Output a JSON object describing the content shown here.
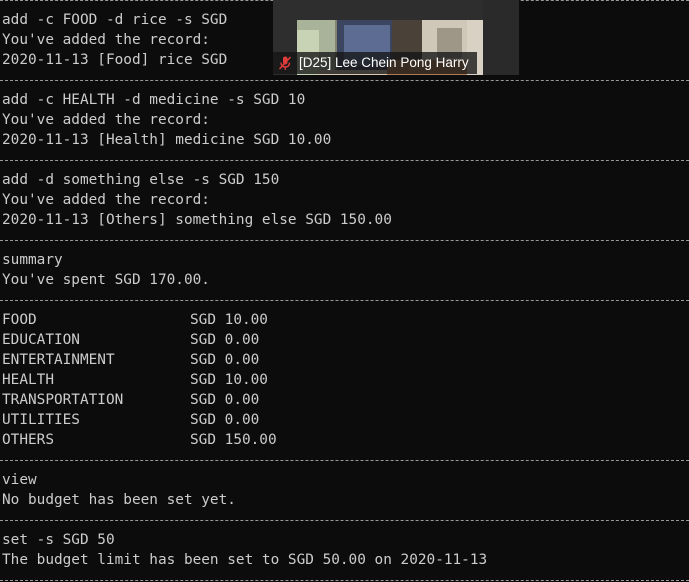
{
  "terminal": {
    "lines": {
      "l0": "add -c FOOD -d rice -s SGD",
      "l1": "You've added the record:",
      "l2": "2020-11-13 [Food] rice SGD",
      "l3": "add -c HEALTH -d medicine -s SGD 10",
      "l4": "You've added the record:",
      "l5": "2020-11-13 [Health] medicine SGD 10.00",
      "l6": "add -d something else -s SGD 150",
      "l7": "You've added the record:",
      "l8": "2020-11-13 [Others] something else SGD 150.00",
      "l9": "summary",
      "l10": "You've spent SGD 170.00.",
      "l11": "view",
      "l12": "No budget has been set yet.",
      "l13": "set -s SGD 50",
      "l14": "The budget limit has been set to SGD 50.00 on 2020-11-13"
    },
    "categories": [
      {
        "name": "FOOD",
        "amount": "SGD 10.00"
      },
      {
        "name": "EDUCATION",
        "amount": "SGD 0.00"
      },
      {
        "name": "ENTERTAINMENT",
        "amount": "SGD 0.00"
      },
      {
        "name": "HEALTH",
        "amount": "SGD 10.00"
      },
      {
        "name": "TRANSPORTATION",
        "amount": "SGD 0.00"
      },
      {
        "name": "UTILITIES",
        "amount": "SGD 0.00"
      },
      {
        "name": "OTHERS",
        "amount": "SGD 150.00"
      }
    ]
  },
  "video": {
    "participant_name": "[D25] Lee Chein Pong Harry",
    "mic_icon": "mic-muted-icon"
  },
  "colors": {
    "background": "#0c0c0c",
    "text": "#cccccc",
    "mic_muted": "#e03c3c"
  }
}
